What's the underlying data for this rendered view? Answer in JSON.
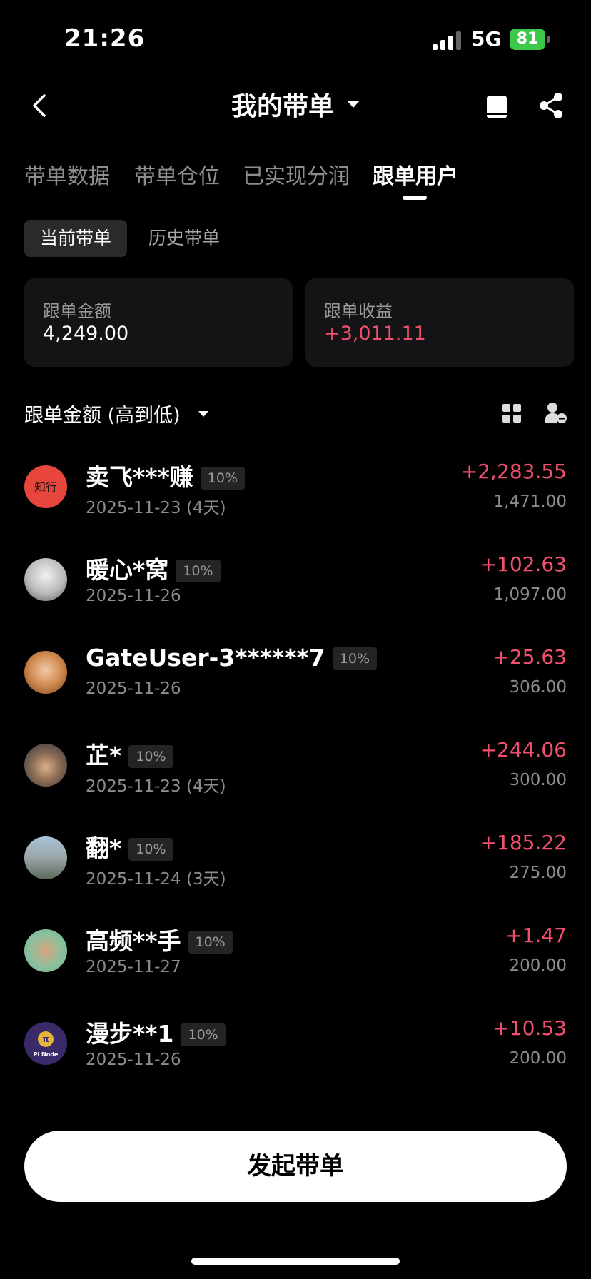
{
  "status_bar": {
    "time": "21:26",
    "network": "5G",
    "battery": "81"
  },
  "header": {
    "title": "我的带单"
  },
  "tabs": [
    {
      "label": "带单数据",
      "active": false
    },
    {
      "label": "带单仓位",
      "active": false
    },
    {
      "label": "已实现分润",
      "active": false
    },
    {
      "label": "跟单用户",
      "active": true
    }
  ],
  "segment": {
    "current": "当前带单",
    "history": "历史带单"
  },
  "summary": {
    "follow_amount_label": "跟单金额",
    "follow_amount_value": "4,249.00",
    "follow_profit_label": "跟单收益",
    "follow_profit_value": "+3,011.11"
  },
  "sort": {
    "label": "跟单金额 (高到低)"
  },
  "users": [
    {
      "name": "卖飞***赚",
      "badge": "10%",
      "date": "2025-11-23 (4天)",
      "pnl": "+2,283.55",
      "amount": "1,471.00",
      "avatar_color": "#e8453c"
    },
    {
      "name": "暖心*窝",
      "badge": "10%",
      "date": "2025-11-26",
      "pnl": "+102.63",
      "amount": "1,097.00",
      "avatar_color": "#d9d9d9"
    },
    {
      "name": "GateUser-3******7",
      "badge": "10%",
      "date": "2025-11-26",
      "pnl": "+25.63",
      "amount": "306.00",
      "avatar_color": "#c9773a"
    },
    {
      "name": "芷*",
      "badge": "10%",
      "date": "2025-11-23 (4天)",
      "pnl": "+244.06",
      "amount": "300.00",
      "avatar_color": "#3b4a5e"
    },
    {
      "name": "翻*",
      "badge": "10%",
      "date": "2025-11-24 (3天)",
      "pnl": "+185.22",
      "amount": "275.00",
      "avatar_color": "#7e8c95"
    },
    {
      "name": "高频**手",
      "badge": "10%",
      "date": "2025-11-27",
      "pnl": "+1.47",
      "amount": "200.00",
      "avatar_color": "#7fc7a0"
    },
    {
      "name": "漫步**1",
      "badge": "10%",
      "date": "2025-11-26",
      "pnl": "+10.53",
      "amount": "200.00",
      "avatar_color": "#3a2a6a",
      "avatar_text": "Pi Node"
    }
  ],
  "cta": {
    "label": "发起带单"
  },
  "colors": {
    "positive": "#f0506e",
    "background": "#000000",
    "card": "#141416"
  }
}
